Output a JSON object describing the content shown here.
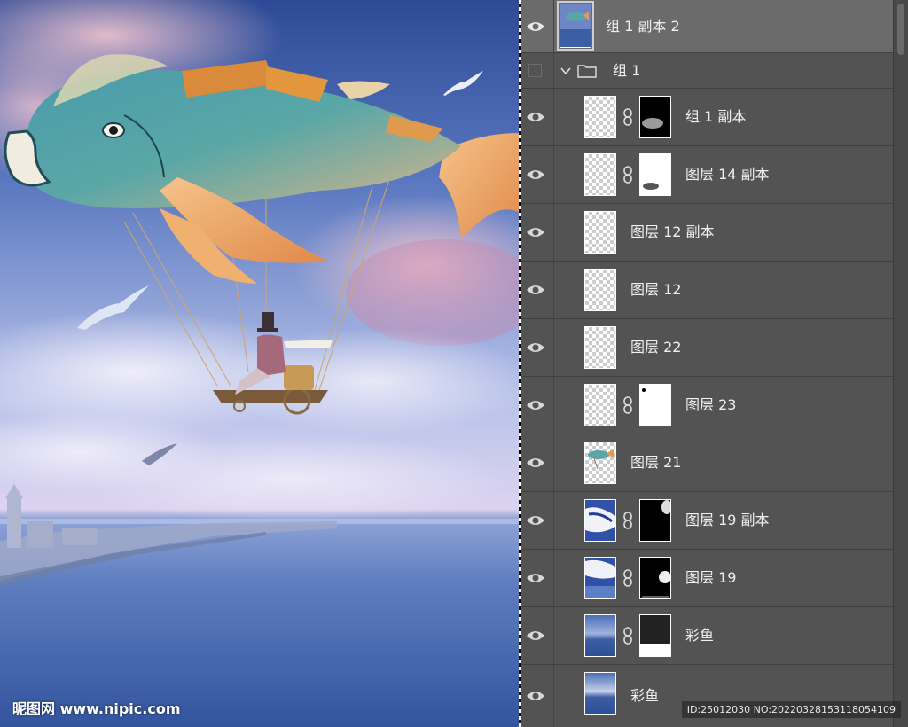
{
  "canvas": {
    "watermark": "昵图网 www.nipic.com"
  },
  "layers": [
    {
      "name": "组 1 副本 2",
      "visible": true,
      "selected": true,
      "type": "smart-object"
    },
    {
      "name": "组 1",
      "visible": false,
      "type": "group",
      "expanded": true
    },
    {
      "name": "组 1 副本",
      "visible": true,
      "has_mask": true
    },
    {
      "name": "图层 14 副本",
      "visible": true,
      "has_mask": true
    },
    {
      "name": "图层 12 副本",
      "visible": true,
      "has_mask": false
    },
    {
      "name": "图层 12",
      "visible": true,
      "has_mask": false
    },
    {
      "name": "图层 22",
      "visible": true,
      "has_mask": false
    },
    {
      "name": "图层 23",
      "visible": true,
      "has_mask": true
    },
    {
      "name": "图层 21",
      "visible": true,
      "has_mask": false
    },
    {
      "name": "图层 19 副本",
      "visible": true,
      "has_mask": true
    },
    {
      "name": "图层 19",
      "visible": true,
      "has_mask": true
    },
    {
      "name": "彩鱼",
      "visible": true,
      "has_mask": true
    },
    {
      "name": "彩鱼",
      "visible": true,
      "has_mask": false
    }
  ],
  "id_watermark": "ID:25012030 NO:20220328153118054109",
  "icons": {
    "eye": "eye-icon",
    "link": "link-icon",
    "folder": "folder-icon",
    "chevron": "chevron-down-icon"
  },
  "colors": {
    "panel_bg": "#535353",
    "selected_row": "#6b6b6b",
    "sky_top": "#2f4f9a",
    "sea": "#3e63a8"
  }
}
